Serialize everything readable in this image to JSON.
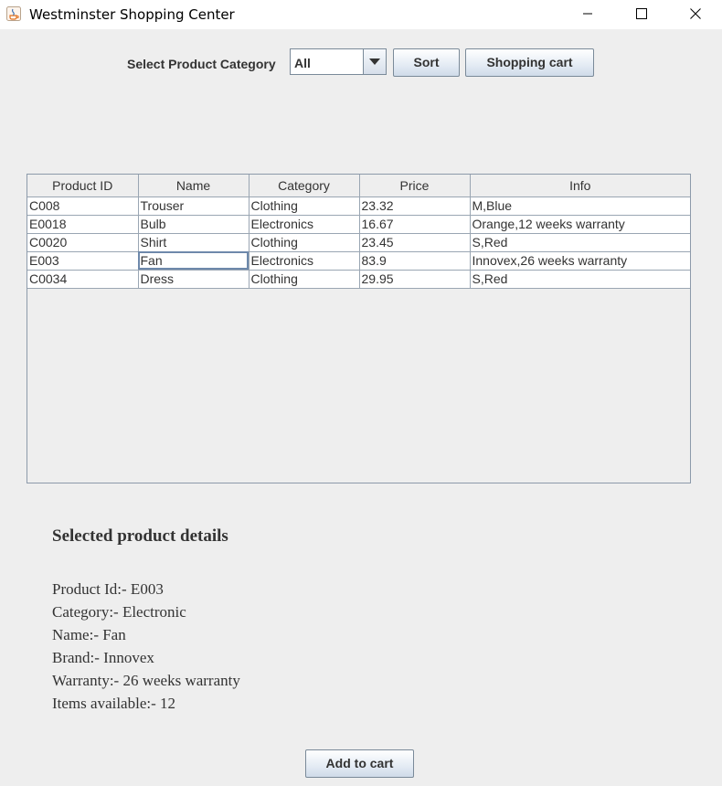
{
  "window": {
    "title": "Westminster Shopping Center",
    "icon": "java-icon"
  },
  "toolbar": {
    "category_label": "Select Product Category",
    "category_selected": "All",
    "sort_label": "Sort",
    "cart_label": "Shopping cart"
  },
  "table": {
    "columns": [
      "Product ID",
      "Name",
      "Category",
      "Price",
      "Info"
    ],
    "rows": [
      [
        "C008",
        "Trouser",
        "Clothing",
        "23.32",
        "M,Blue"
      ],
      [
        "E0018",
        "Bulb",
        "Electronics",
        "16.67",
        "Orange,12 weeks warranty"
      ],
      [
        "C0020",
        "Shirt",
        "Clothing",
        "23.45",
        "S,Red"
      ],
      [
        "E003",
        "Fan",
        "Electronics",
        "83.9",
        "Innovex,26 weeks warranty"
      ],
      [
        "C0034",
        "Dress",
        "Clothing",
        "29.95",
        "S,Red"
      ]
    ],
    "focused_cell": "Fan"
  },
  "details": {
    "title": "Selected product details",
    "lines": [
      "Product Id:- E003",
      "Category:- Electronic",
      "Name:- Fan",
      "Brand:- Innovex",
      "Warranty:- 26 weeks warranty",
      "Items available:- 12"
    ]
  },
  "actions": {
    "add_to_cart_label": "Add to cart"
  }
}
